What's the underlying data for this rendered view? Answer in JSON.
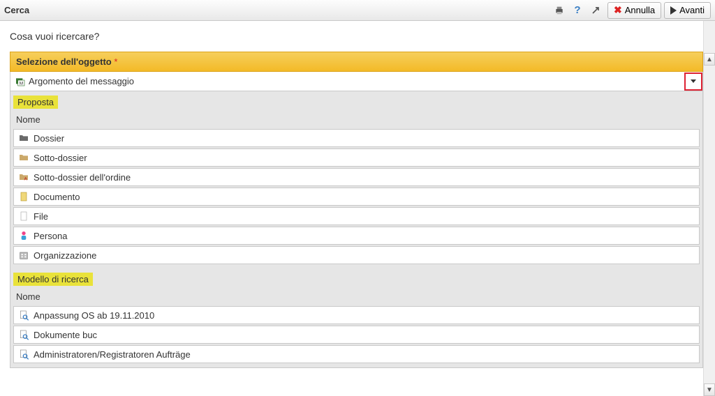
{
  "toolbar": {
    "title": "Cerca",
    "cancel_label": "Annulla",
    "next_label": "Avanti"
  },
  "prompt": "Cosa vuoi ricercare?",
  "object_selection": {
    "header": "Selezione dell'oggetto",
    "required_mark": "*",
    "selected": "Argomento del messaggio"
  },
  "proposal": {
    "badge": "Proposta",
    "column": "Nome",
    "items": [
      {
        "icon": "folder-dark",
        "label": "Dossier"
      },
      {
        "icon": "folder-light",
        "label": "Sotto-dossier"
      },
      {
        "icon": "folder-a",
        "label": "Sotto-dossier dell'ordine"
      },
      {
        "icon": "doc",
        "label": "Documento"
      },
      {
        "icon": "file",
        "label": "File"
      },
      {
        "icon": "person",
        "label": "Persona"
      },
      {
        "icon": "org",
        "label": "Organizzazione"
      }
    ]
  },
  "search_model": {
    "badge": "Modello di ricerca",
    "column": "Nome",
    "items": [
      {
        "icon": "searchdoc",
        "label": "Anpassung OS ab 19.11.2010"
      },
      {
        "icon": "searchdoc",
        "label": "Dokumente buc"
      },
      {
        "icon": "searchdoc",
        "label": "Administratoren/Registratoren Aufträge"
      }
    ]
  }
}
